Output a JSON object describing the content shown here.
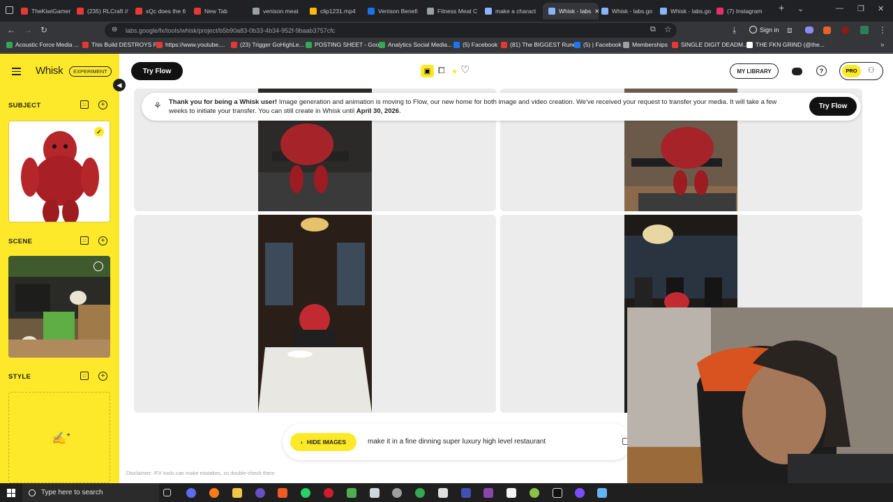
{
  "browser": {
    "tabs": [
      {
        "label": "TheKiwiGamer",
        "color": "#e53935"
      },
      {
        "label": "(235) RLCraft //",
        "color": "#e53935"
      },
      {
        "label": "xQc does the 6",
        "color": "#e53935"
      },
      {
        "label": "New Tab",
        "color": "#e53935"
      },
      {
        "label": "venison meat",
        "color": "#9aa0a6"
      },
      {
        "label": "clip1231.mp4",
        "color": "#fbbc04"
      },
      {
        "label": "Venison Benefi",
        "color": "#1a73e8"
      },
      {
        "label": "Fitness Meat C",
        "color": "#9aa0a6"
      },
      {
        "label": "make a charact",
        "color": "#8ab4f8"
      },
      {
        "label": "Whisk - labs",
        "color": "#8ab4f8",
        "active": true
      },
      {
        "label": "Whisk - labs.go",
        "color": "#8ab4f8"
      },
      {
        "label": "Whisk - labs.go",
        "color": "#8ab4f8"
      },
      {
        "label": "(7) Instagram",
        "color": "#e1306c"
      }
    ],
    "url": "labs.google/fx/tools/whisk/project/b5b90a83-0b33-4b34-952f-9baab3757cfc",
    "sign_in": "Sign in",
    "bookmarks": [
      {
        "label": "Acoustic Force Media ...",
        "color": "#34a853"
      },
      {
        "label": "This Build DESTROYS P...",
        "color": "#e53935"
      },
      {
        "label": "https://www.youtube....",
        "color": "#e53935"
      },
      {
        "label": "(23) Trigger GoHighLe...",
        "color": "#e53935"
      },
      {
        "label": "POSTING SHEET - Goo...",
        "color": "#34a853"
      },
      {
        "label": "Analytics Social Media...",
        "color": "#34a853"
      },
      {
        "label": "(5) Facebook",
        "color": "#1877f2"
      },
      {
        "label": "(81) The BIGGEST Rune...",
        "color": "#e53935"
      },
      {
        "label": "(5) | Facebook",
        "color": "#1877f2"
      },
      {
        "label": "Memberships",
        "color": "#9aa0a6"
      },
      {
        "label": "SINGLE DIGIT DEADM...",
        "color": "#e53935"
      },
      {
        "label": "THE FKN GRIND (@the...",
        "color": "#ffffff"
      }
    ]
  },
  "app": {
    "name": "Whisk",
    "badge": "EXPERIMENT",
    "try_flow": "Try Flow",
    "my_library": "MY LIBRARY",
    "pro": "PRO",
    "accent": "#fde92a"
  },
  "sidebar": {
    "subject": "SUBJECT",
    "scene": "SCENE",
    "style": "STYLE"
  },
  "banner": {
    "bold_lead": "Thank you for being a Whisk user!",
    "text": " Image generation and animation is moving to Flow, our new home for both image and video creation. We've received your request to transfer your media. It will take a few weeks to initiate your transfer. You can still create in Whisk until ",
    "date": "April 30, 2026",
    "end": ".",
    "button": "Try Flow"
  },
  "prompt": {
    "hide_images": "HIDE IMAGES",
    "text": "make it in a fine dinning super luxury high level restaurant"
  },
  "disclaimer": "Disclaimer: /FX tools can make mistakes, so double-check them",
  "taskbar": {
    "search": "Type here to search"
  }
}
